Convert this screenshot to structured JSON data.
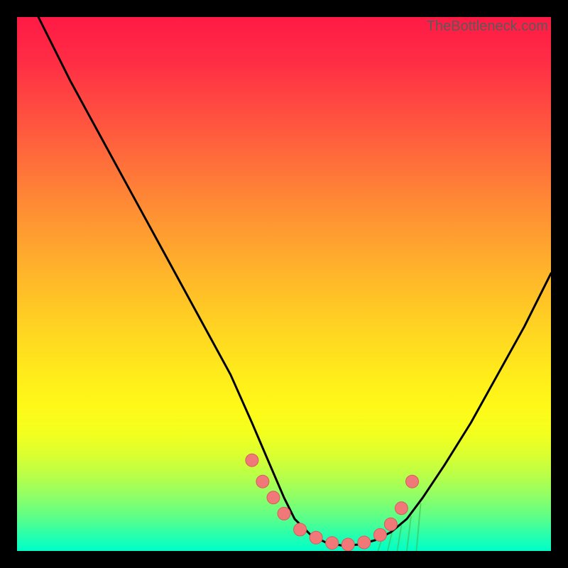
{
  "watermark": "TheBottleneck.com",
  "chart_data": {
    "type": "line",
    "title": "",
    "xlabel": "",
    "ylabel": "",
    "xlim": [
      0,
      100
    ],
    "ylim": [
      0,
      100
    ],
    "curve": {
      "x": [
        4,
        10,
        16,
        22,
        28,
        34,
        40,
        44,
        47,
        50,
        52,
        55,
        58,
        61,
        64,
        67,
        70,
        73,
        76,
        80,
        85,
        90,
        95,
        100
      ],
      "y": [
        100,
        88,
        77,
        66,
        55,
        44,
        33,
        24,
        17,
        10,
        6,
        3,
        1.5,
        1,
        1.2,
        2,
        3.5,
        6,
        10,
        16,
        24,
        33,
        42,
        52
      ]
    },
    "markers": {
      "x": [
        44,
        46,
        48,
        50,
        53,
        56,
        59,
        62,
        65,
        68,
        70,
        72,
        74
      ],
      "y": [
        17,
        13,
        10,
        7,
        4,
        2.5,
        1.5,
        1.2,
        1.6,
        3,
        5,
        8,
        13
      ]
    },
    "hatch_area": {
      "x_start": 68,
      "x_end": 76,
      "y_base": 0,
      "pattern": "diagonal-green"
    },
    "colors": {
      "curve": "#000000",
      "marker_fill": "#f07878",
      "marker_stroke": "#d85c5c",
      "hatch": "#3fb84f",
      "gradient_top": "#ff1a45",
      "gradient_bottom": "#00ffc8"
    }
  }
}
